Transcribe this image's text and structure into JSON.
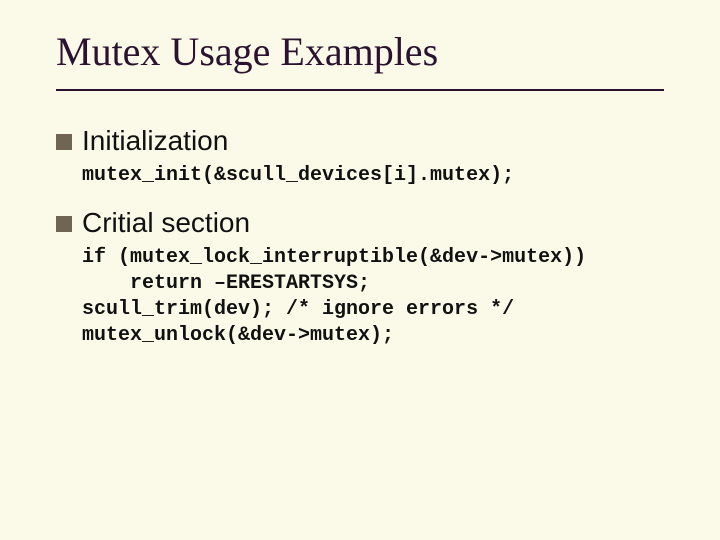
{
  "slide": {
    "title": "Mutex Usage Examples",
    "items": [
      {
        "heading": "Initialization",
        "code": "mutex_init(&scull_devices[i].mutex);"
      },
      {
        "heading": "Critial section",
        "code": "if (mutex_lock_interruptible(&dev->mutex))\n    return –ERESTARTSYS;\nscull_trim(dev); /* ignore errors */\nmutex_unlock(&dev->mutex);"
      }
    ]
  }
}
